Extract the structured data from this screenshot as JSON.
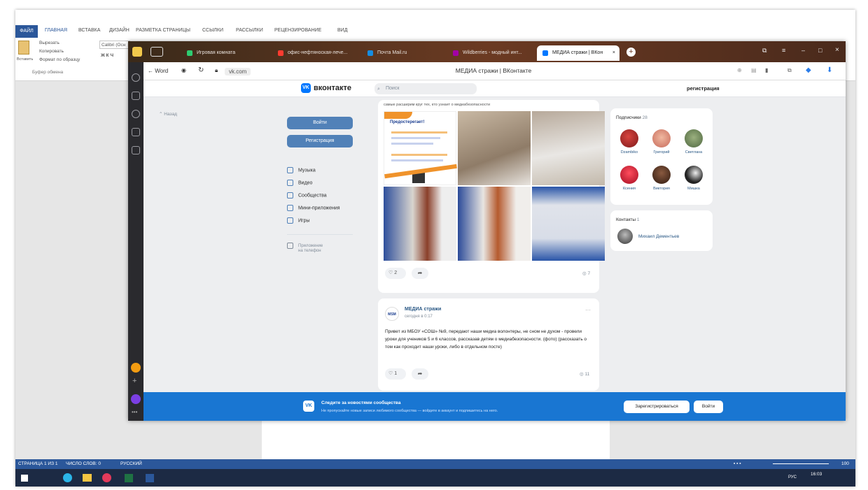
{
  "word": {
    "tabs": [
      "ФАЙЛ",
      "ГЛАВНАЯ",
      "ВСТАВКА",
      "ДИЗАЙН",
      "РАЗМЕТКА СТРАНИЦЫ",
      "ССЫЛКИ",
      "РАССЫЛКИ",
      "РЕЦЕНЗИРОВАНИЕ",
      "ВИД"
    ],
    "clipboard": {
      "cut": "Вырезать",
      "copy": "Копировать",
      "paste": "Вставить",
      "format": "Формат по образцу",
      "group": "Буфер обмена"
    },
    "font": "Calibri (Осн",
    "status_pages": "СТРАНИЦА 1 ИЗ 1",
    "status_words": "ЧИСЛО СЛОВ: 0",
    "status_lang": "РУССКИЙ",
    "zoom": "100",
    "tray_lang": "РУС",
    "time": "16:03"
  },
  "browser": {
    "tabs": [
      {
        "label": "Игровая комната",
        "color": "#2ecc71"
      },
      {
        "label": "офис-нефтяноская-лече...",
        "color": "#ff3b30"
      },
      {
        "label": "Почта Mail.ru",
        "color": "#168de2"
      },
      {
        "label": "Wildberries - модный инт...",
        "color": "#a300a6"
      },
      {
        "label": "МЕДИА стражи | ВКон",
        "color": "#0077ff",
        "active": true
      }
    ],
    "back_label": "Word",
    "url": "vk.com",
    "page_title": "МЕДИА стражи | ВКонтакте"
  },
  "vk": {
    "brand": "вконтакте",
    "search_placeholder": "Поиск",
    "register_link": "регистрация",
    "back": "Назад",
    "login_button": "Войти",
    "register_button": "Регистрация",
    "nav": [
      "Музыка",
      "Видео",
      "Сообщества",
      "Мини-приложения",
      "Игры"
    ],
    "apps_on_phone": [
      "Приложение",
      "на телефон"
    ],
    "post1": {
      "caption": "самые расширим круг тех, кто узнает о медиабезопасности",
      "poster_title": "Предостерегает!",
      "likes": "2",
      "views": "7"
    },
    "post2": {
      "author": "МЕДИА стражи",
      "time": "сегодня в 0:17",
      "text": "Привет из МБОУ «СОШ» №9, передают наши медиа волонтеры, не сном не духом - провели уроки для учеников 5 и 6 классов, рассказав детям о медиабезопасности. (фото) (рассказать о том как проходит наши уроки, либо в отдельном посте)",
      "likes": "1",
      "views": "11"
    },
    "subscribers": {
      "title": "Подписчики",
      "count": "28",
      "people": [
        {
          "name": "Dzambiko",
          "color": "#b3262a"
        },
        {
          "name": "Григорий",
          "color": "#d97b6c"
        },
        {
          "name": "Светлана",
          "color": "#6f8a5a"
        },
        {
          "name": "Ксения",
          "color": "#e01e3c"
        },
        {
          "name": "Виктория",
          "color": "#5a3322"
        },
        {
          "name": "Мишка",
          "color": "#333333"
        }
      ]
    },
    "contacts": {
      "title": "Контакты",
      "count": "1",
      "name": "Михаил Дементьев"
    },
    "banner": {
      "title": "Следите за новостями сообщества",
      "subtitle": "Не пропускайте новые записи любимого сообщества — войдите в аккаунт и подпишитесь на него.",
      "register": "Зарегистрироваться",
      "login": "Войти"
    }
  }
}
